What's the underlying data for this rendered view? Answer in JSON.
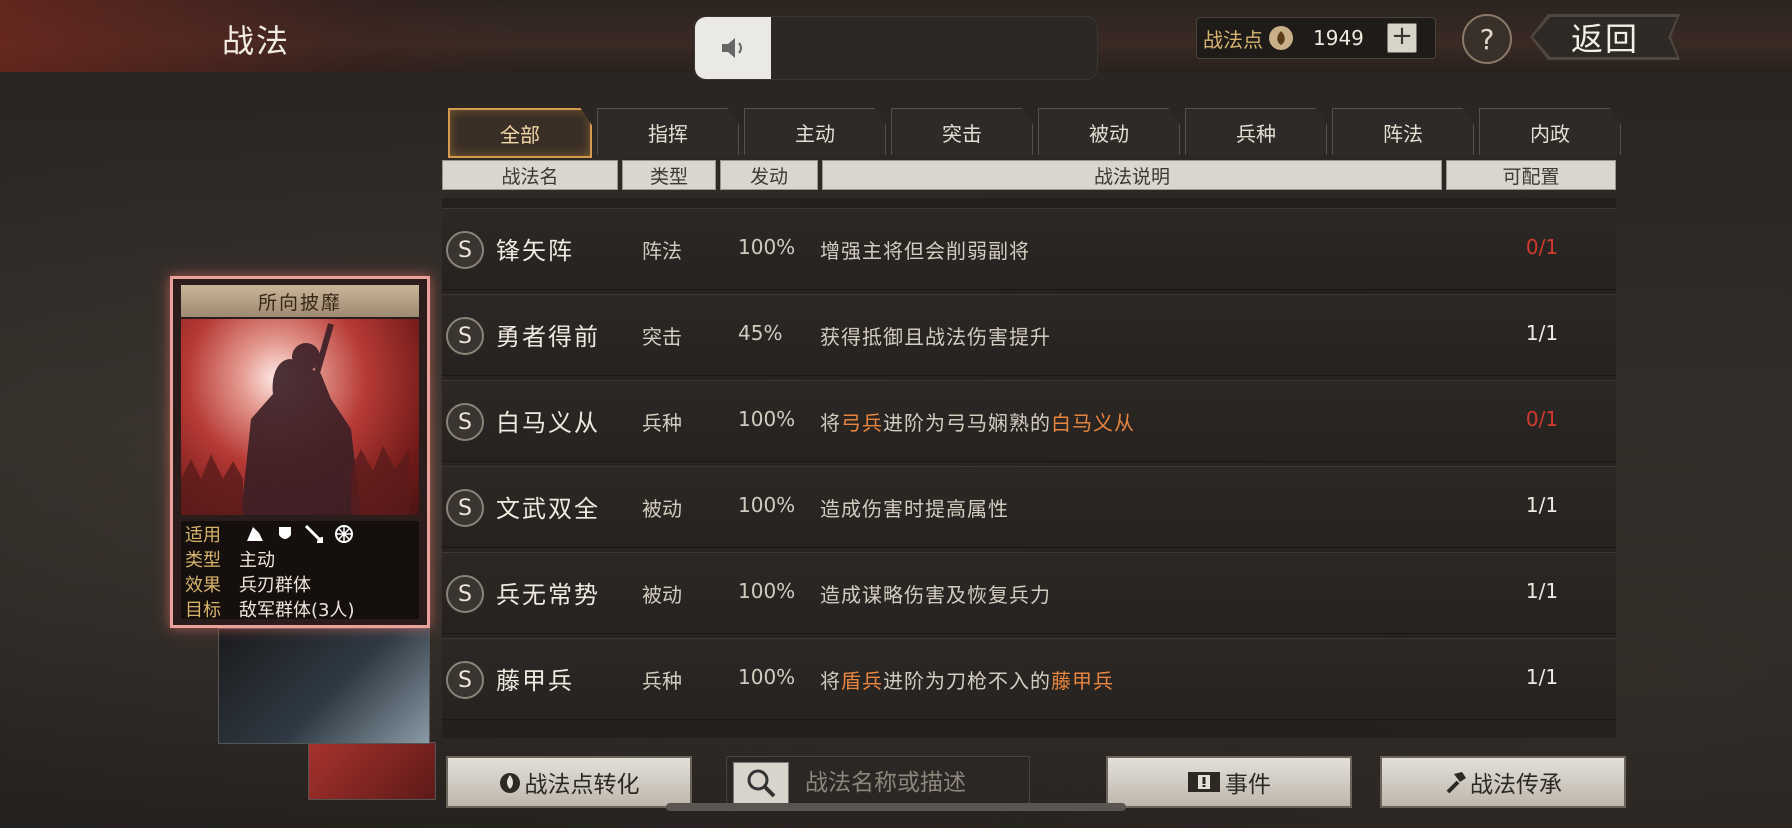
{
  "header": {
    "title": "战法",
    "points_label": "战法点",
    "points_value": "1949",
    "plus_label": "+",
    "help_label": "?",
    "back_label": "返回"
  },
  "tabs": [
    {
      "label": "全部",
      "active": true
    },
    {
      "label": "指挥"
    },
    {
      "label": "主动"
    },
    {
      "label": "突击"
    },
    {
      "label": "被动"
    },
    {
      "label": "兵种"
    },
    {
      "label": "阵法"
    },
    {
      "label": "内政"
    }
  ],
  "columns": {
    "name": "战法名",
    "type": "类型",
    "rate": "发动",
    "desc": "战法说明",
    "config": "可配置"
  },
  "rows": [
    {
      "grade": "S",
      "name": "锋矢阵",
      "type": "阵法",
      "rate": "100%",
      "desc_parts": [
        {
          "t": "增强主将但会削弱副将"
        }
      ],
      "config": "0/1",
      "config_color": "red"
    },
    {
      "grade": "S",
      "name": "勇者得前",
      "type": "突击",
      "rate": "45%",
      "desc_parts": [
        {
          "t": "获得抵御且战法伤害提升"
        }
      ],
      "config": "1/1",
      "config_color": "white"
    },
    {
      "grade": "S",
      "name": "白马义从",
      "type": "兵种",
      "rate": "100%",
      "desc_parts": [
        {
          "t": "将"
        },
        {
          "t": "弓兵",
          "hl": true
        },
        {
          "t": "进阶为弓马娴熟的"
        },
        {
          "t": "白马义从",
          "hl": true
        }
      ],
      "config": "0/1",
      "config_color": "red"
    },
    {
      "grade": "S",
      "name": "文武双全",
      "type": "被动",
      "rate": "100%",
      "desc_parts": [
        {
          "t": "造成伤害时提高属性"
        }
      ],
      "config": "1/1",
      "config_color": "white"
    },
    {
      "grade": "S",
      "name": "兵无常势",
      "type": "被动",
      "rate": "100%",
      "desc_parts": [
        {
          "t": "造成谋略伤害及恢复兵力"
        }
      ],
      "config": "1/1",
      "config_color": "white"
    },
    {
      "grade": "S",
      "name": "藤甲兵",
      "type": "兵种",
      "rate": "100%",
      "desc_parts": [
        {
          "t": "将"
        },
        {
          "t": "盾兵",
          "hl": true
        },
        {
          "t": "进阶为刀枪不入的"
        },
        {
          "t": "藤甲兵",
          "hl": true
        }
      ],
      "config": "1/1",
      "config_color": "white"
    }
  ],
  "card": {
    "title": "所向披靡",
    "info": [
      {
        "key": "适用",
        "val": ""
      },
      {
        "key": "类型",
        "val": "主动"
      },
      {
        "key": "效果",
        "val": "兵刃群体"
      },
      {
        "key": "目标",
        "val": "敌军群体(3人)"
      }
    ]
  },
  "bottom": {
    "convert_label": "战法点转化",
    "search_placeholder": "战法名称或描述",
    "event_label": "事件",
    "inherit_label": "战法传承"
  },
  "colors": {
    "accent": "#d59a50",
    "highlight": "#e8863f",
    "config_red": "#d23a2e"
  }
}
